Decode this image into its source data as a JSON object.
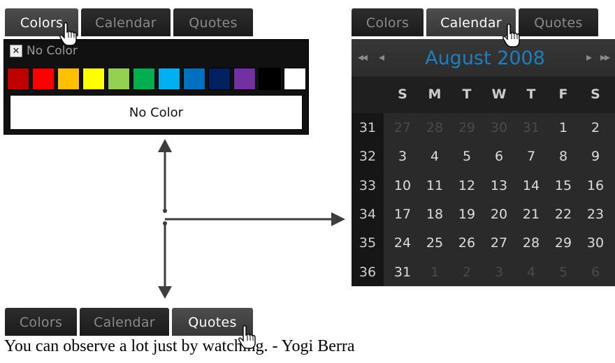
{
  "colors_widget": {
    "tabs": [
      "Colors",
      "Calendar",
      "Quotes"
    ],
    "active_tab": "Colors",
    "no_color_checkbox_mark": "✕",
    "no_color_label": "No Color",
    "swatches": [
      "#c00000",
      "#ff0000",
      "#ffc000",
      "#ffff00",
      "#92d050",
      "#00b050",
      "#00b0f0",
      "#0070c0",
      "#002060",
      "#7030a0",
      "#000000",
      "#ffffff"
    ],
    "preview_text": "No Color"
  },
  "calendar_widget": {
    "tabs": [
      "Colors",
      "Calendar",
      "Quotes"
    ],
    "active_tab": "Calendar",
    "nav_first": "◂◂",
    "nav_prev": "◂",
    "nav_next": "▸",
    "nav_last": "▸▸",
    "month_title": "August 2008",
    "weekdays": [
      "S",
      "M",
      "T",
      "W",
      "T",
      "F",
      "S"
    ],
    "week_numbers": [
      "31",
      "32",
      "33",
      "34",
      "35",
      "36"
    ],
    "weeks": [
      [
        {
          "d": "27",
          "o": true
        },
        {
          "d": "28",
          "o": true
        },
        {
          "d": "29",
          "o": true
        },
        {
          "d": "30",
          "o": true
        },
        {
          "d": "31",
          "o": true
        },
        {
          "d": "1",
          "o": false
        },
        {
          "d": "2",
          "o": false
        }
      ],
      [
        {
          "d": "3",
          "o": false
        },
        {
          "d": "4",
          "o": false
        },
        {
          "d": "5",
          "o": false
        },
        {
          "d": "6",
          "o": false
        },
        {
          "d": "7",
          "o": false
        },
        {
          "d": "8",
          "o": false
        },
        {
          "d": "9",
          "o": false
        }
      ],
      [
        {
          "d": "10",
          "o": false
        },
        {
          "d": "11",
          "o": false
        },
        {
          "d": "12",
          "o": false
        },
        {
          "d": "13",
          "o": false
        },
        {
          "d": "14",
          "o": false
        },
        {
          "d": "15",
          "o": false
        },
        {
          "d": "16",
          "o": false
        }
      ],
      [
        {
          "d": "17",
          "o": false
        },
        {
          "d": "18",
          "o": false
        },
        {
          "d": "19",
          "o": false
        },
        {
          "d": "20",
          "o": false
        },
        {
          "d": "21",
          "o": false
        },
        {
          "d": "22",
          "o": false
        },
        {
          "d": "23",
          "o": false
        }
      ],
      [
        {
          "d": "24",
          "o": false
        },
        {
          "d": "25",
          "o": false
        },
        {
          "d": "26",
          "o": false
        },
        {
          "d": "27",
          "o": false
        },
        {
          "d": "28",
          "o": false
        },
        {
          "d": "29",
          "o": false
        },
        {
          "d": "30",
          "o": false
        }
      ],
      [
        {
          "d": "31",
          "o": false
        },
        {
          "d": "1",
          "o": true
        },
        {
          "d": "2",
          "o": true
        },
        {
          "d": "3",
          "o": true
        },
        {
          "d": "4",
          "o": true
        },
        {
          "d": "5",
          "o": true
        },
        {
          "d": "6",
          "o": true
        }
      ]
    ]
  },
  "quotes_widget": {
    "tabs": [
      "Colors",
      "Calendar",
      "Quotes"
    ],
    "active_tab": "Quotes",
    "quote_text": "You can observe a lot just by watching. - Yogi Berra"
  },
  "colors": {
    "tab_bg": "#1f1f1f",
    "tab_active_bg": "#454545",
    "calendar_title": "#1e7fbf",
    "arrow": "#3d3d3d"
  }
}
